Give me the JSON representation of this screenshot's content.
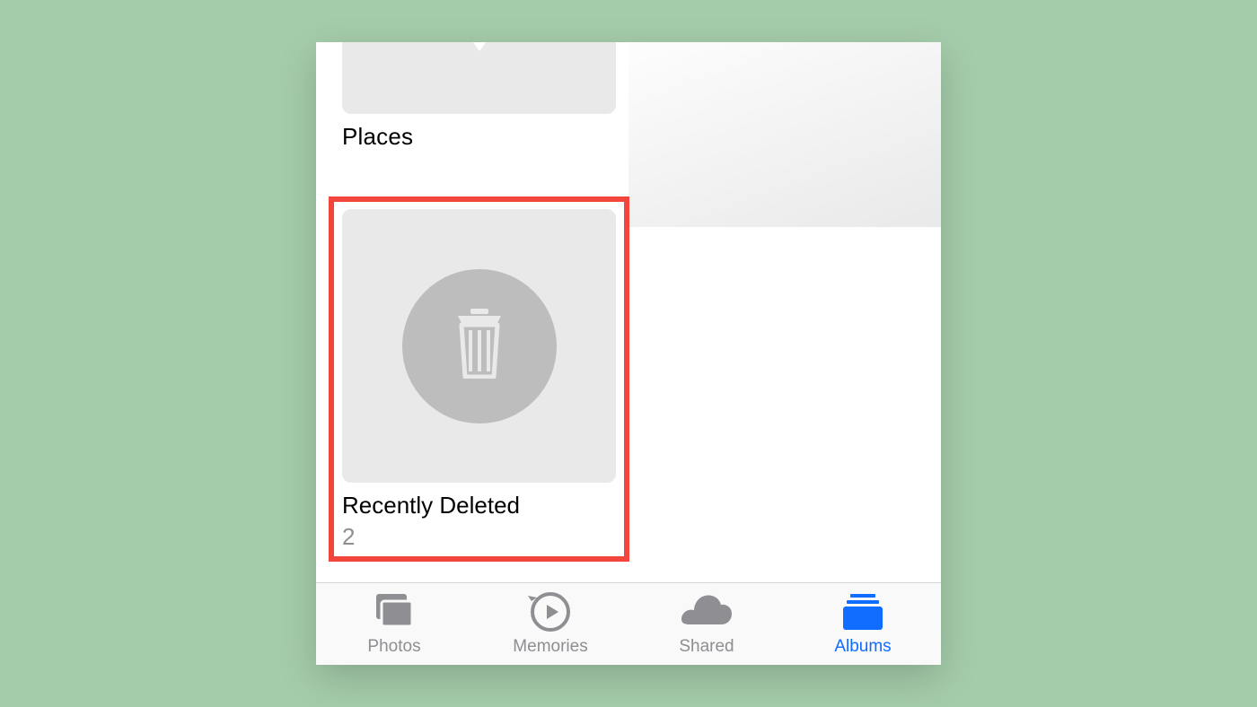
{
  "albums": {
    "places": {
      "label": "Places"
    },
    "recently_deleted": {
      "label": "Recently Deleted",
      "count": "2"
    }
  },
  "tabbar": {
    "items": [
      {
        "label": "Photos",
        "active": false
      },
      {
        "label": "Memories",
        "active": false
      },
      {
        "label": "Shared",
        "active": false
      },
      {
        "label": "Albums",
        "active": true
      }
    ]
  },
  "colors": {
    "accent": "#0f6dff",
    "inactive": "#8e8e93",
    "highlight_border": "#f2463d",
    "page_bg": "#a5ccaa"
  }
}
